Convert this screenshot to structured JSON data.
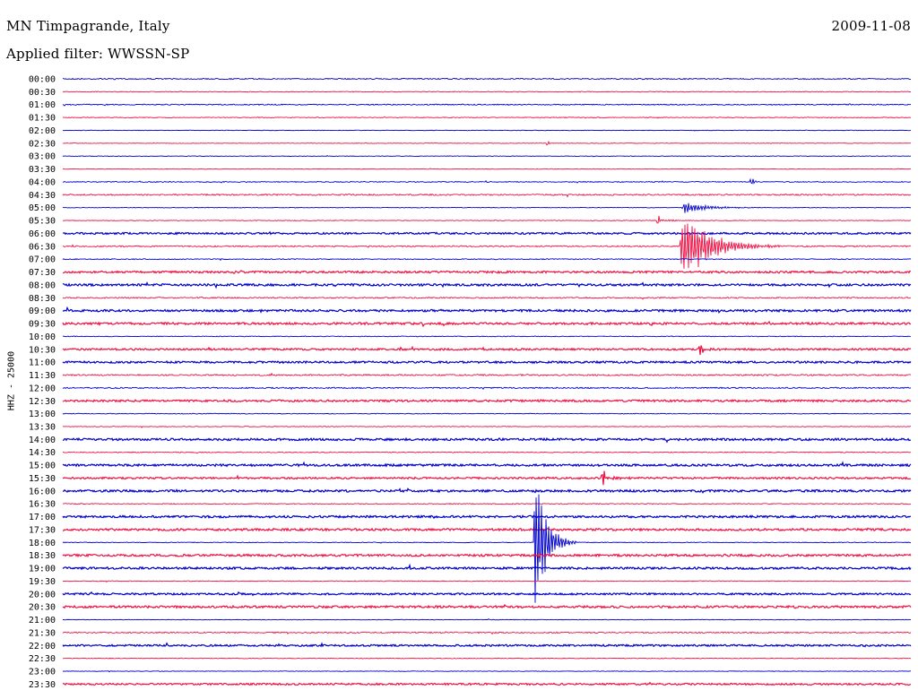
{
  "header": {
    "station": "MN Timpagrande, Italy",
    "filter_label": "Applied filter:",
    "filter_value": "WWSSN-SP",
    "date": "2009-11-08"
  },
  "channel_label": "HHZ - 25000",
  "colors": {
    "trace_a": "#0000cc",
    "trace_b": "#ee1144",
    "background": "#ffffff",
    "text": "#000000"
  },
  "chart_data": {
    "type": "line",
    "title": "MN Timpagrande, Italy",
    "subtitle": "Applied filter: WWSSN-SP",
    "date": "2009-11-08",
    "ylabel": "HHZ - 25000",
    "row_labels": [
      "00:00",
      "00:30",
      "01:00",
      "01:30",
      "02:00",
      "02:30",
      "03:00",
      "03:30",
      "04:00",
      "04:30",
      "05:00",
      "05:30",
      "06:00",
      "06:30",
      "07:00",
      "07:30",
      "08:00",
      "08:30",
      "09:00",
      "09:30",
      "10:00",
      "10:30",
      "11:00",
      "11:30",
      "12:00",
      "12:30",
      "13:00",
      "13:30",
      "14:00",
      "14:30",
      "15:00",
      "15:30",
      "16:00",
      "16:30",
      "17:00",
      "17:30",
      "18:00",
      "18:30",
      "19:00",
      "19:30",
      "20:00",
      "20:30",
      "21:00",
      "21:30",
      "22:00",
      "22:30",
      "23:00",
      "23:30"
    ],
    "row_colors": "alternating blue / red, starting blue at 00:00",
    "row_noise_level": [
      0.6,
      0.4,
      0.6,
      0.4,
      0.3,
      0.3,
      0.3,
      0.3,
      0.5,
      0.8,
      0.3,
      0.4,
      1.0,
      0.7,
      0.5,
      1.1,
      1.2,
      0.7,
      1.2,
      1.2,
      0.4,
      1.0,
      1.1,
      0.8,
      0.7,
      1.1,
      0.4,
      0.4,
      1.2,
      0.5,
      1.2,
      1.0,
      1.2,
      0.5,
      1.2,
      1.2,
      0.4,
      1.2,
      1.2,
      0.4,
      1.0,
      1.2,
      0.3,
      0.7,
      1.0,
      0.4,
      0.3,
      1.0
    ],
    "events": [
      {
        "row_label": "05:00",
        "position": 0.73,
        "amplitude": 8,
        "duration": 0.1,
        "character": "earthquake onset"
      },
      {
        "row_label": "06:30",
        "position": 0.727,
        "amplitude": 52,
        "duration": 0.12,
        "character": "earthquake main shaking"
      },
      {
        "row_label": "05:30",
        "position": 0.7,
        "amplitude": 9,
        "duration": 0.05,
        "character": "step"
      },
      {
        "row_label": "15:30",
        "position": 0.635,
        "amplitude": 12,
        "duration": 0.05,
        "character": "step"
      },
      {
        "row_label": "18:00",
        "position": 0.555,
        "amplitude": 105,
        "duration": 0.05,
        "character": "earthquake"
      },
      {
        "row_label": "04:00",
        "position": 0.81,
        "amplitude": 6,
        "duration": 0.01,
        "character": "spike"
      },
      {
        "row_label": "02:30",
        "position": 0.57,
        "amplitude": 5,
        "duration": 0.005,
        "character": "spike"
      },
      {
        "row_label": "10:30",
        "position": 0.75,
        "amplitude": 6,
        "duration": 0.06,
        "character": "step"
      }
    ]
  }
}
